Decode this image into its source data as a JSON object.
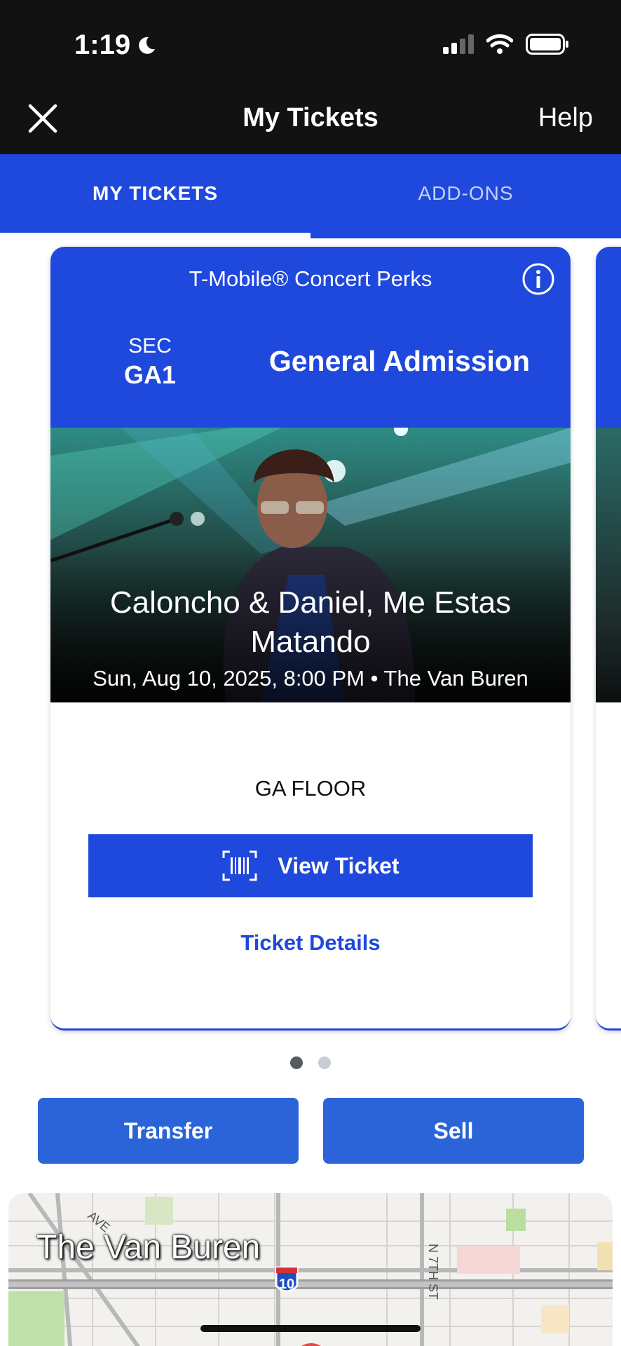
{
  "status_bar": {
    "time": "1:19"
  },
  "header": {
    "title": "My Tickets",
    "help": "Help"
  },
  "tabs": [
    {
      "label": "MY TICKETS",
      "active": true
    },
    {
      "label": "ADD-ONS",
      "active": false
    }
  ],
  "ticket": {
    "perks": "T-Mobile® Concert Perks",
    "sec_label": "SEC",
    "sec_value": "GA1",
    "admission": "General Admission",
    "event_title": "Caloncho & Daniel, Me Estas Matando",
    "event_meta": "Sun, Aug 10, 2025, 8:00 PM • The Van Buren",
    "area": "GA FLOOR",
    "view_ticket": "View Ticket",
    "ticket_details": "Ticket Details"
  },
  "pagination": {
    "total": 2,
    "current": 1
  },
  "actions": {
    "transfer": "Transfer",
    "sell": "Sell"
  },
  "map": {
    "venue": "The Van Buren",
    "street_1": "AVE",
    "street_2": "N 7TH ST",
    "highway": "10"
  },
  "colors": {
    "brand_blue": "#1f48dc",
    "button_blue": "#2a64d8",
    "header_dark": "#121212"
  }
}
